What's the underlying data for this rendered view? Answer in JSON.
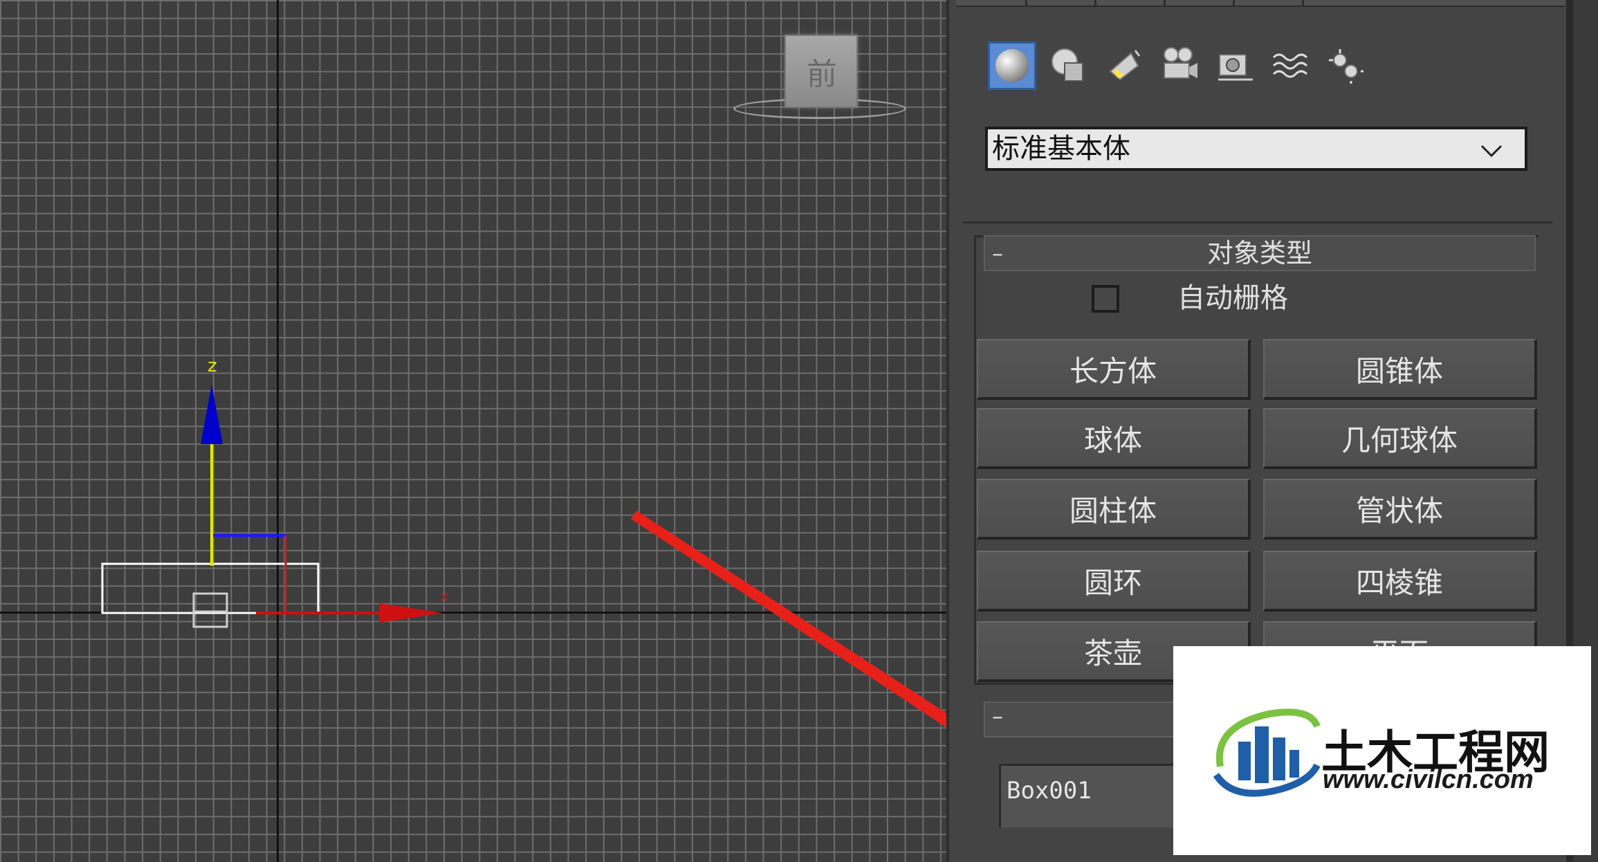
{
  "viewport": {
    "viewcube_label": "前",
    "axis_z_label": "z",
    "axis_x_label": "x"
  },
  "panel": {
    "category_icons": [
      "geometry-sphere-icon",
      "shapes-icon",
      "lights-icon",
      "cameras-icon",
      "helpers-icon",
      "spacewarps-icon",
      "systems-icon"
    ],
    "dropdown_value": "标准基本体",
    "rollout_title": "对象类型",
    "rollout_collapse": "–",
    "autogrid_label": "自动栅格",
    "autogrid_checked": false,
    "buttons": [
      "长方体",
      "圆锥体",
      "球体",
      "几何球体",
      "圆柱体",
      "管状体",
      "圆环",
      "四棱锥",
      "茶壶",
      "平面"
    ],
    "name_rollout_collapse": "–",
    "object_name": "Box001"
  },
  "watermark": {
    "site_name": "土木工程网",
    "site_url": "www.civilcn.com"
  },
  "colors": {
    "accent_blue": "#2e5c9e",
    "arrow_red": "#e8201a",
    "axis_yellow": "#e6e600",
    "axis_blue": "#0000cc"
  }
}
